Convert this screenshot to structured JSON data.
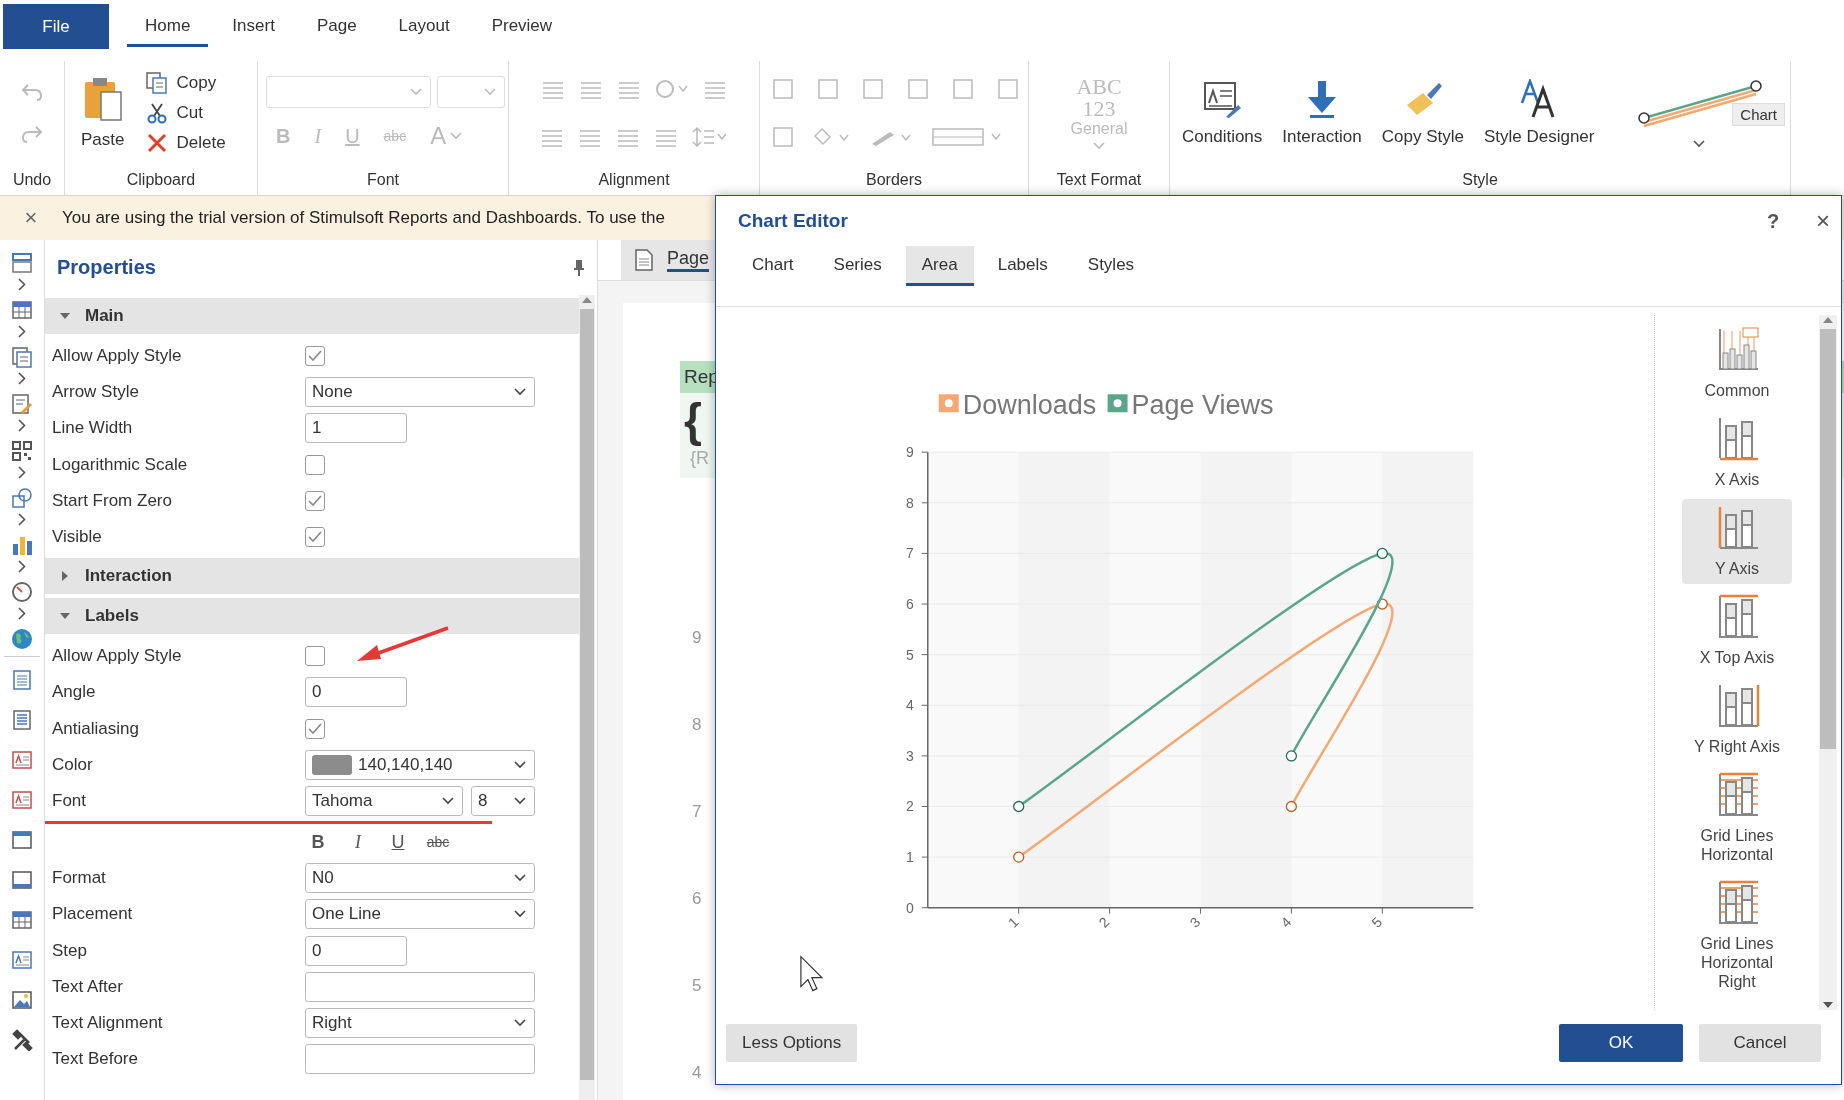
{
  "ribbon": {
    "file_button": "File",
    "tabs": [
      {
        "label": "Home",
        "selected": true
      },
      {
        "label": "Insert",
        "selected": false
      },
      {
        "label": "Page",
        "selected": false
      },
      {
        "label": "Layout",
        "selected": false
      },
      {
        "label": "Preview",
        "selected": false
      }
    ],
    "undo_group": {
      "label": "Undo",
      "disabled": true
    },
    "clipboard_group": {
      "label": "Clipboard",
      "paste": "Paste",
      "items": [
        "Copy",
        "Cut",
        "Delete"
      ]
    },
    "font_group": {
      "label": "Font",
      "disabled": true,
      "style_buttons": [
        "B",
        "I",
        "U",
        "abc"
      ],
      "color_button": "A"
    },
    "alignment_group": {
      "label": "Alignment",
      "disabled": true
    },
    "borders_group": {
      "label": "Borders",
      "disabled": true
    },
    "text_format_group": {
      "label": "Text Format",
      "disabled": true,
      "sample": "ABC",
      "sample_2": "123",
      "format": "General"
    },
    "style_group": {
      "label": "Style",
      "buttons": [
        "Conditions",
        "Interaction",
        "Copy Style",
        "Style Designer"
      ],
      "preview_label": "Chart"
    }
  },
  "trial_bar": {
    "close": "×",
    "message": "You are using the trial version of Stimulsoft Reports and Dashboards. To use the"
  },
  "properties": {
    "title": "Properties",
    "sections": [
      {
        "title": "Main",
        "expanded": true,
        "rows": [
          {
            "kind": "checkbox",
            "label": "Allow Apply Style",
            "checked": true
          },
          {
            "kind": "dropdown",
            "label": "Arrow Style",
            "value": "None"
          },
          {
            "kind": "input",
            "label": "Line Width",
            "value": "1"
          },
          {
            "kind": "checkbox",
            "label": "Logarithmic Scale",
            "checked": false
          },
          {
            "kind": "checkbox",
            "label": "Start From Zero",
            "checked": true
          },
          {
            "kind": "checkbox",
            "label": "Visible",
            "checked": true
          }
        ]
      },
      {
        "title": "Interaction",
        "expanded": false
      },
      {
        "title": "Labels",
        "expanded": true,
        "rows": [
          {
            "kind": "checkbox",
            "label": "Allow Apply Style",
            "checked": false
          },
          {
            "kind": "input",
            "label": "Angle",
            "value": "0"
          },
          {
            "kind": "checkbox",
            "label": "Antialiasing",
            "checked": true
          },
          {
            "kind": "color",
            "label": "Color",
            "value": "140,140,140"
          },
          {
            "kind": "font",
            "label": "Font",
            "value": "Tahoma",
            "size": "8",
            "style_buttons": [
              "B",
              "I",
              "U",
              "abc"
            ]
          },
          {
            "kind": "dropdown",
            "label": "Format",
            "value": "N0"
          },
          {
            "kind": "dropdown",
            "label": "Placement",
            "value": "One Line"
          },
          {
            "kind": "input",
            "label": "Step",
            "value": "0"
          },
          {
            "kind": "input",
            "label": "Text After"
          },
          {
            "kind": "dropdown",
            "label": "Text Alignment",
            "value": "Right"
          },
          {
            "kind": "input",
            "label": "Text Before"
          }
        ]
      }
    ]
  },
  "page_area": {
    "tab": "Page",
    "band_title": "Rep",
    "band_text": "{",
    "band_field": "{R",
    "ruler": [
      "9",
      "8",
      "7",
      "6",
      "5",
      "4"
    ]
  },
  "chart_editor": {
    "title": "Chart Editor",
    "help": "?",
    "close": "×",
    "tabs": [
      {
        "label": "Chart",
        "selected": false
      },
      {
        "label": "Series",
        "selected": false
      },
      {
        "label": "Area",
        "selected": true
      },
      {
        "label": "Labels",
        "selected": false
      },
      {
        "label": "Styles",
        "selected": false
      }
    ],
    "chart_data": {
      "type": "line",
      "x": [
        1,
        5,
        4
      ],
      "series": [
        {
          "name": "Downloads",
          "color": "#f5a872",
          "values": [
            1,
            6,
            2
          ],
          "marker": true
        },
        {
          "name": "Page Views",
          "color": "#5ba68b",
          "values": [
            2,
            7,
            3
          ],
          "marker": true
        }
      ],
      "grid": true,
      "legend": true,
      "xlim": [
        0,
        6
      ],
      "ylim": [
        0,
        9
      ],
      "xticks": [
        1,
        2,
        3,
        4,
        5
      ],
      "yticks": [
        0,
        1,
        2,
        3,
        4,
        5,
        6,
        7,
        8,
        9
      ]
    },
    "sidebar": [
      {
        "label": "Common",
        "selected": false
      },
      {
        "label": "X Axis",
        "selected": false
      },
      {
        "label": "Y Axis",
        "selected": true
      },
      {
        "label": "X Top Axis",
        "selected": false
      },
      {
        "label": "Y Right Axis",
        "selected": false
      },
      {
        "label": "Grid Lines Horizontal",
        "selected": false
      },
      {
        "label": "Grid Lines Horizontal Right",
        "selected": false
      }
    ],
    "less_options": "Less Options",
    "ok": "OK",
    "cancel": "Cancel"
  }
}
